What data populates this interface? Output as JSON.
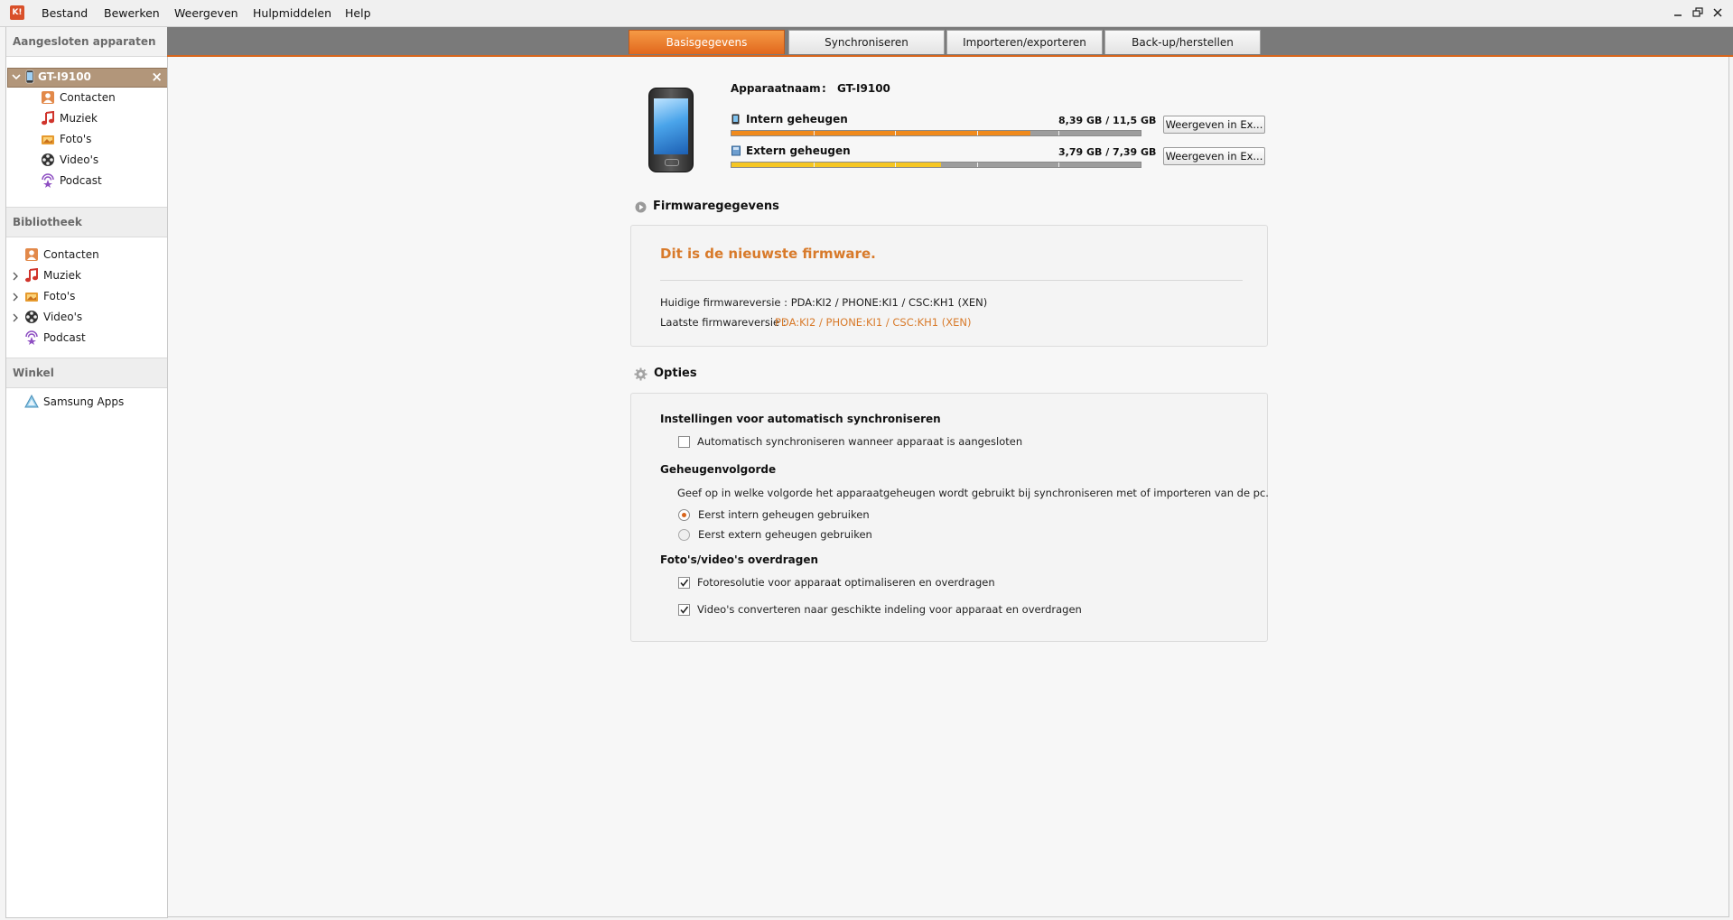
{
  "menu": {
    "logo": "K!",
    "items": [
      "Bestand",
      "Bewerken",
      "Weergeven",
      "Hulpmiddelen",
      "Help"
    ]
  },
  "sidebar": {
    "connected_header": "Aangesloten apparaten",
    "device": {
      "name": "GT-I9100",
      "close": "×"
    },
    "device_items": [
      {
        "label": "Contacten",
        "icon": "contacts-icon"
      },
      {
        "label": "Muziek",
        "icon": "music-icon"
      },
      {
        "label": "Foto's",
        "icon": "photos-icon"
      },
      {
        "label": "Video's",
        "icon": "video-icon"
      },
      {
        "label": "Podcast",
        "icon": "podcast-icon"
      }
    ],
    "library_header": "Bibliotheek",
    "library_items": [
      {
        "label": "Contacten",
        "icon": "contacts-icon"
      },
      {
        "label": "Muziek",
        "icon": "music-icon"
      },
      {
        "label": "Foto's",
        "icon": "photos-icon"
      },
      {
        "label": "Video's",
        "icon": "video-icon"
      },
      {
        "label": "Podcast",
        "icon": "podcast-icon"
      }
    ],
    "store_header": "Winkel",
    "store_items": [
      {
        "label": "Samsung Apps",
        "icon": "samsung-apps-icon"
      }
    ]
  },
  "tabs": [
    {
      "label": "Basisgegevens",
      "active": true
    },
    {
      "label": "Synchroniseren",
      "active": false
    },
    {
      "label": "Importeren/exporteren",
      "active": false
    },
    {
      "label": "Back-up/herstellen",
      "active": false
    }
  ],
  "device_info": {
    "name_label": "Apparaatnaam",
    "separator": ":",
    "name_value": "GT-I9100",
    "internal": {
      "label": "Intern geheugen",
      "usage": "8,39 GB / 11,5 GB",
      "fraction": 0.73,
      "color": "#f08a1c",
      "button": "Weergeven in Ex..."
    },
    "external": {
      "label": "Extern geheugen",
      "usage": "3,79 GB / 7,39 GB",
      "fraction": 0.513,
      "color": "#f5c623",
      "button": "Weergeven in Ex..."
    }
  },
  "firmware": {
    "title": "Firmwaregegevens",
    "status": "Dit is de nieuwste firmware.",
    "current_label": "Huidige firmwareversie : PDA:KI2 / PHONE:KI1 / CSC:KH1 (XEN)",
    "latest_label": "Laatste firmwareversie :",
    "latest_value": "PDA:KI2 / PHONE:KI1 / CSC:KH1 (XEN)"
  },
  "options": {
    "title": "Opties",
    "autosync_heading": "Instellingen voor automatisch synchroniseren",
    "autosync_checkbox": {
      "label": "Automatisch synchroniseren wanneer apparaat is aangesloten",
      "checked": false
    },
    "memory_order_heading": "Geheugenvolgorde",
    "memory_order_desc": "Geef op in welke volgorde het apparaatgeheugen wordt gebruikt bij synchroniseren met of importeren van de pc.",
    "radio_internal": {
      "label": "Eerst intern geheugen gebruiken",
      "selected": true
    },
    "radio_external": {
      "label": "Eerst extern geheugen gebruiken",
      "selected": false
    },
    "transfer_heading": "Foto's/video's overdragen",
    "photo_checkbox": {
      "label": "Fotoresolutie voor apparaat optimaliseren en overdragen",
      "checked": true
    },
    "video_checkbox": {
      "label": "Video's converteren naar geschikte indeling voor apparaat en overdragen",
      "checked": true
    }
  },
  "colors": {
    "accent": "#d8651c",
    "firmware_status": "#d87a2a"
  }
}
